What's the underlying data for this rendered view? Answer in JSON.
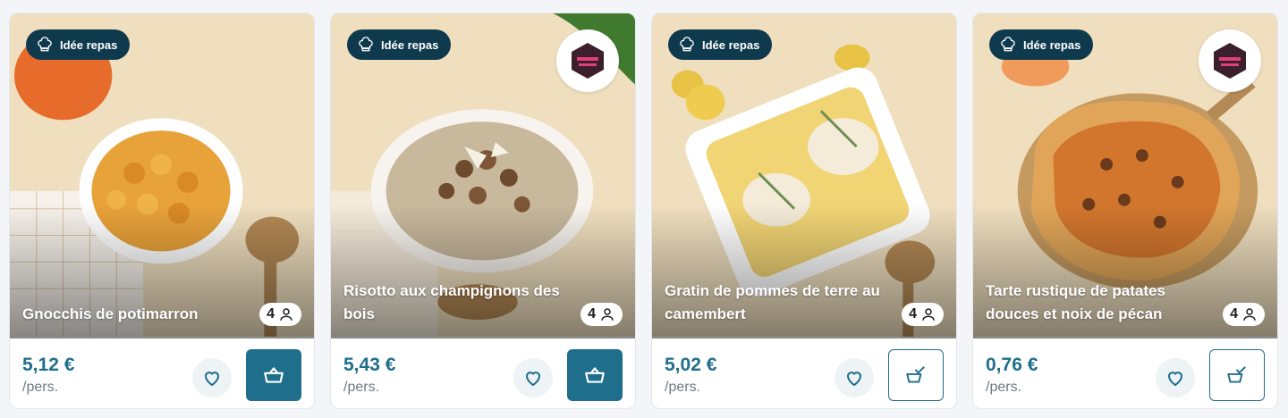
{
  "badge_label": "Idée repas",
  "cards": [
    {
      "title": "Gnocchis de potimarron",
      "servings": "4",
      "price": "5,12 €",
      "unit": "/pers.",
      "has_brand_logo": false,
      "action": "add-to-basket"
    },
    {
      "title": "Risotto aux champignons des bois",
      "servings": "4",
      "price": "5,43 €",
      "unit": "/pers.",
      "has_brand_logo": true,
      "action": "add-to-basket"
    },
    {
      "title": "Gratin de pommes de terre au camembert",
      "servings": "4",
      "price": "5,02 €",
      "unit": "/pers.",
      "has_brand_logo": false,
      "action": "in-basket"
    },
    {
      "title": "Tarte rustique de patates douces et noix de pécan",
      "servings": "4",
      "price": "0,76 €",
      "unit": "/pers.",
      "has_brand_logo": true,
      "action": "in-basket"
    }
  ],
  "colors": {
    "accent": "#1e6e8c",
    "badge_bg": "#0f3a4e",
    "photo_bg": "#efdfbf"
  },
  "icons": [
    "chef-hat-icon",
    "person-icon",
    "heart-icon",
    "basket-icon",
    "basket-check-icon"
  ]
}
